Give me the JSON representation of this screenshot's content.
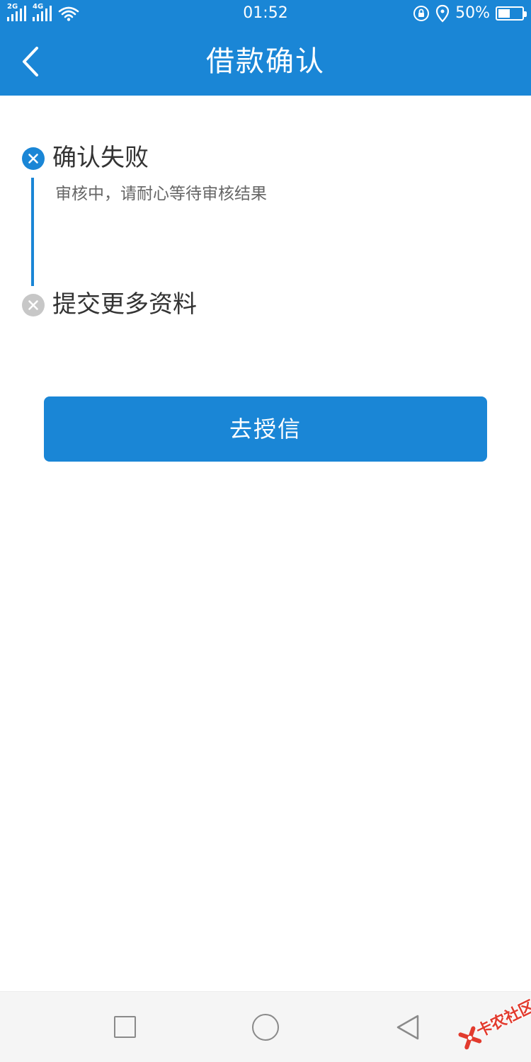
{
  "status_bar": {
    "sim1_tag": "2G",
    "sim2_tag": "4G",
    "time": "01:52",
    "battery_percent": "50%",
    "battery_level": 0.5,
    "icons": [
      "signal-icon",
      "wifi-icon",
      "rotation-lock-icon",
      "location-icon",
      "battery-icon"
    ]
  },
  "nav": {
    "title": "借款确认",
    "back_icon": "back-arrow-icon"
  },
  "steps": [
    {
      "title": "确认失败",
      "status": "failed",
      "description": "审核中，请耐心等待审核结果"
    },
    {
      "title": "提交更多资料",
      "status": "pending"
    }
  ],
  "action": {
    "button_label": "去授信"
  },
  "system_nav": {
    "icons": [
      "recent-apps-icon",
      "home-icon",
      "back-icon"
    ]
  },
  "watermark": {
    "text": "卡农社区"
  },
  "colors": {
    "primary": "#1a86d6",
    "step_pending": "#c7c7c7",
    "watermark": "#e23b2e"
  }
}
